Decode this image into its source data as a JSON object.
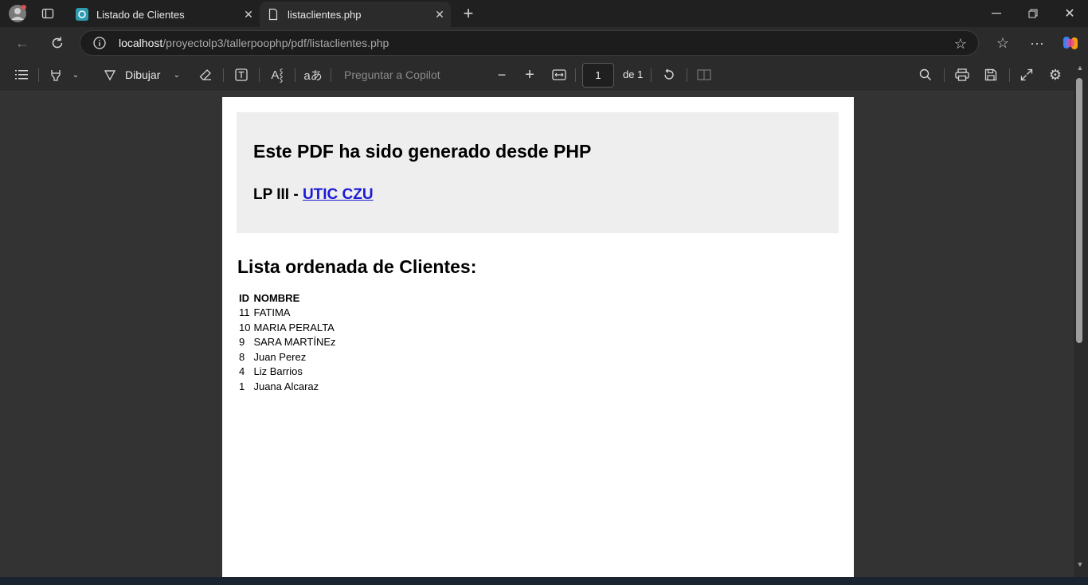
{
  "tabs": [
    {
      "title": "Listado de Clientes",
      "active": false
    },
    {
      "title": "listaclientes.php",
      "active": true
    }
  ],
  "address": {
    "host": "localhost",
    "path": "/proyectolp3/tallerpoophp/pdf/listaclientes.php"
  },
  "pdf_toolbar": {
    "draw_label": "Dibujar",
    "copilot_placeholder": "Preguntar a Copilot",
    "page_value": "1",
    "page_total": "de 1"
  },
  "document": {
    "heading": "Este PDF ha sido generado desde PHP",
    "subheading_prefix": "LP III - ",
    "subheading_link": " UTIC CZU ",
    "list_title": "Lista ordenada de Clientes:",
    "columns": [
      "ID",
      "NOMBRE"
    ],
    "rows": [
      [
        "11",
        "FATIMA"
      ],
      [
        "10",
        "MARIA PERALTA"
      ],
      [
        "9",
        "SARA MARTÍNEz"
      ],
      [
        "8",
        "Juan Perez"
      ],
      [
        "4",
        "Liz Barrios"
      ],
      [
        "1",
        "Juana Alcaraz"
      ]
    ]
  },
  "colors": {
    "link": "#1a1ad6",
    "banner_bg": "#eeeeee",
    "chrome_bg": "#202020"
  }
}
